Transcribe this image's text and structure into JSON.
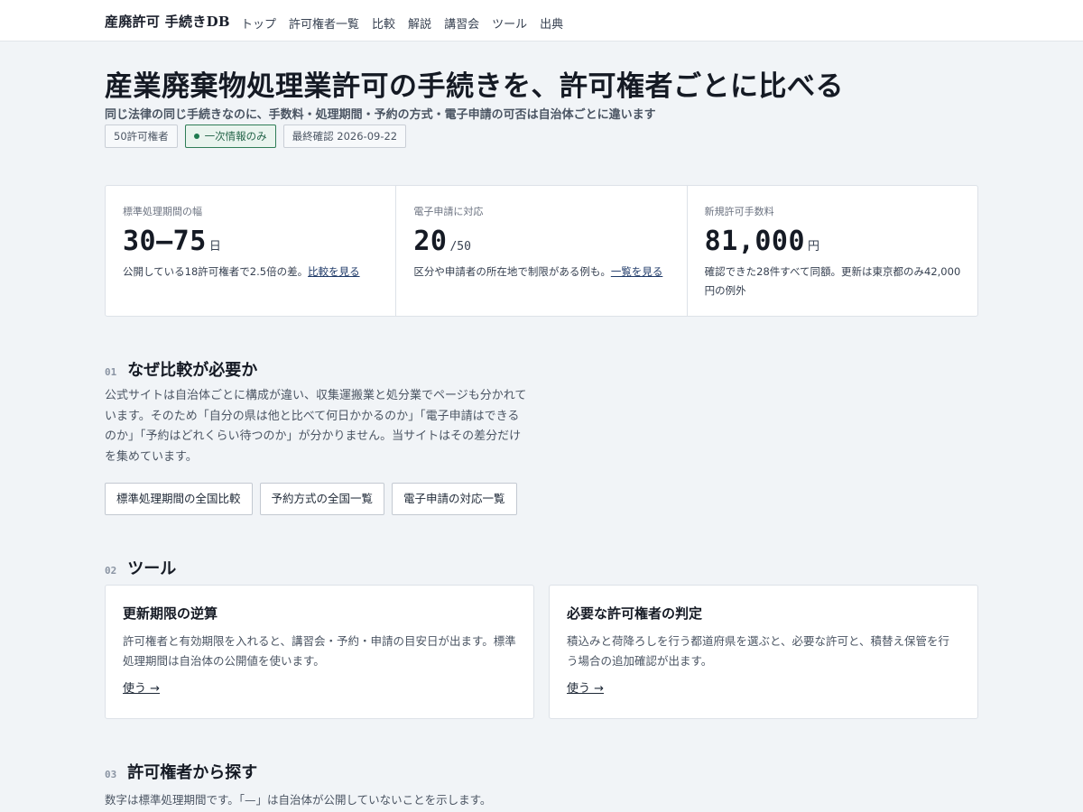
{
  "header": {
    "brand": "産廃許可 手続きDB",
    "nav": [
      "トップ",
      "許可権者一覧",
      "比較",
      "解説",
      "講習会",
      "ツール",
      "出典"
    ]
  },
  "hero": {
    "title": "産業廃棄物処理業許可の手続きを、許可権者ごとに比べる",
    "subtitle": "同じ法律の同じ手続きなのに、手数料・処理期間・予約の方式・電子申請の可否は自治体ごとに違います",
    "chips": {
      "authorities": "50許可権者",
      "primary": "一次情報のみ",
      "last_checked": "最終確認 2026-09-22"
    }
  },
  "stats": [
    {
      "label": "標準処理期間の幅",
      "value": "30–75",
      "unit": "日",
      "note": "公開している18許可権者で2.5倍の差。",
      "link": "比較を見る"
    },
    {
      "label": "電子申請に対応",
      "value": "20",
      "unit": "/50",
      "note": "区分や申請者の所在地で制限がある例も。",
      "link": "一覧を見る"
    },
    {
      "label": "新規許可手数料",
      "value": "81,000",
      "unit": "円",
      "note": "確認できた28件すべて同額。更新は東京都のみ42,000円の例外",
      "link": ""
    }
  ],
  "section1": {
    "num": "01",
    "title": "なぜ比較が必要か",
    "body": "公式サイトは自治体ごとに構成が違い、収集運搬業と処分業でページも分かれています。そのため「自分の県は他と比べて何日かかるのか」「電子申請はできるのか」「予約はどれくらい待つのか」が分かりません。当サイトはその差分だけを集めています。",
    "buttons": [
      "標準処理期間の全国比較",
      "予約方式の全国一覧",
      "電子申請の対応一覧"
    ]
  },
  "section2": {
    "num": "02",
    "title": "ツール",
    "cards": [
      {
        "title": "更新期限の逆算",
        "desc": "許可権者と有効期限を入れると、講習会・予約・申請の目安日が出ます。標準処理期間は自治体の公開値を使います。",
        "link": "使う →"
      },
      {
        "title": "必要な許可権者の判定",
        "desc": "積込みと荷降ろしを行う都道府県を選ぶと、必要な許可と、積替え保管を行う場合の追加確認が出ます。",
        "link": "使う →"
      }
    ]
  },
  "section3": {
    "num": "03",
    "title": "許可権者から探す",
    "note": "数字は標準処理期間です。「—」は自治体が公開していないことを示します。"
  }
}
